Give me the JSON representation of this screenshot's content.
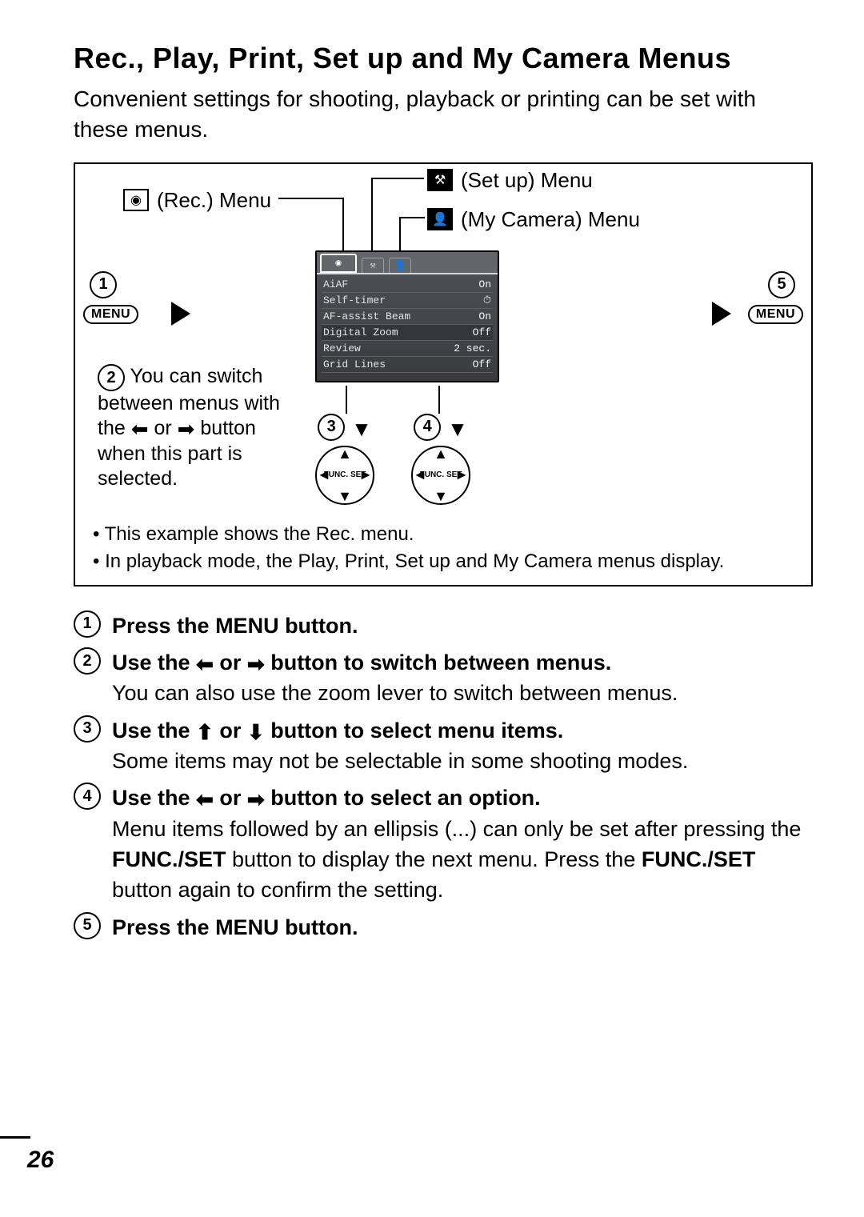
{
  "title": "Rec., Play, Print, Set up and My Camera Menus",
  "intro": "Convenient settings for shooting, playback or printing can be set with these menus.",
  "labels": {
    "rec": "(Rec.) Menu",
    "setup": "(Set up) Menu",
    "mycam": "(My Camera) Menu"
  },
  "lcd": {
    "rows": [
      {
        "name": "AiAF",
        "value": "On"
      },
      {
        "name": "Self-timer",
        "value": "⏱"
      },
      {
        "name": "AF-assist Beam",
        "value": "On"
      },
      {
        "name": "Digital Zoom",
        "value": "Off"
      },
      {
        "name": "Review",
        "value": "2 sec."
      },
      {
        "name": "Grid Lines",
        "value": "Off"
      }
    ]
  },
  "circled": {
    "c1": "1",
    "c2": "2",
    "c3": "3",
    "c4": "4",
    "c5": "5"
  },
  "menu_button_text": "MENU",
  "dpad_center": "FUNC.\nSET",
  "note2_lead": "You can switch between menus with the",
  "note2_tail": "button when this part is selected.",
  "or_word": "or",
  "bullets": {
    "b1": "This example shows the Rec. menu.",
    "b2": "In playback mode, the Play, Print, Set up and My Camera menus display."
  },
  "steps": {
    "s1_head": "Press the MENU button.",
    "s2_head_a": "Use the",
    "s2_head_b": "button to switch between menus.",
    "s2_body": "You can also use the zoom lever to switch between menus.",
    "s3_head_a": "Use the",
    "s3_head_b": "button to select menu items.",
    "s3_body": "Some items may not be selectable in some shooting modes.",
    "s4_head_a": "Use the",
    "s4_head_b": "button to select an option.",
    "s4_body_1": "Menu items followed by an ellipsis (...) can only be set after pressing the ",
    "s4_funcset": "FUNC./SET",
    "s4_body_2": " button to display the next menu. Press the ",
    "s4_body_3": " button again to confirm the setting.",
    "s5_head": "Press the MENU button."
  },
  "page_number": "26"
}
